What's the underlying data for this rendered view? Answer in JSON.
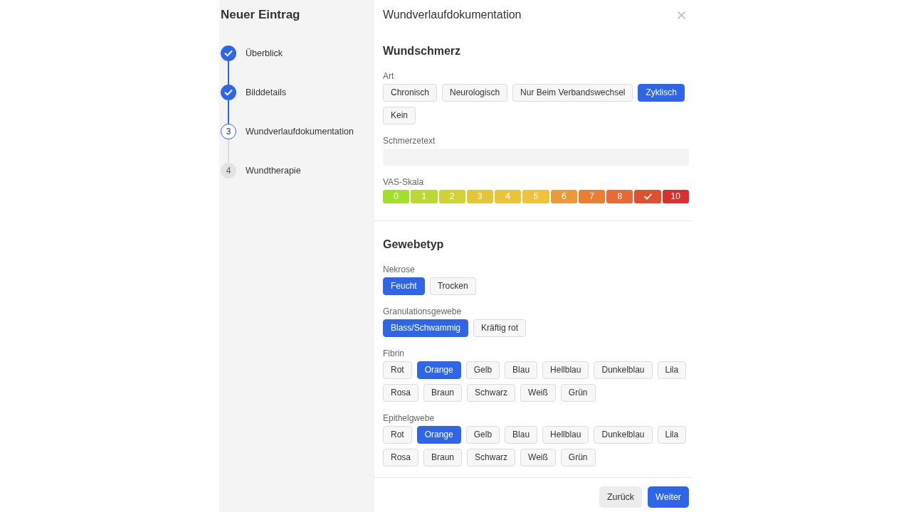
{
  "sidebar": {
    "title": "Neuer Eintrag",
    "steps": [
      {
        "label": "Überblick",
        "completed": true,
        "selected": false
      },
      {
        "label": "Bilddetails",
        "completed": true,
        "selected": false
      },
      {
        "label": "Wundverlaufdokumentation",
        "completed": false,
        "selected": true,
        "number": "3"
      },
      {
        "label": "Wundtherapie",
        "completed": false,
        "selected": false,
        "number": "4"
      }
    ]
  },
  "dialog": {
    "title": "Wundverlaufdokumentation"
  },
  "sections": [
    {
      "title": "Wundschmerz",
      "fields": [
        {
          "kind": "chips",
          "label": "Art",
          "options": [
            {
              "label": "Chronisch",
              "selected": false
            },
            {
              "label": "Neurologisch",
              "selected": false
            },
            {
              "label": "Nur Beim Verbandswechsel",
              "selected": false
            },
            {
              "label": "Zyklisch",
              "selected": true
            },
            {
              "label": "Kein",
              "selected": false
            }
          ]
        },
        {
          "kind": "text",
          "label": "Schmerzetext"
        },
        {
          "kind": "scale",
          "label": "VAS-Skala",
          "segments": [
            {
              "label": "0",
              "color": "#a3e02b",
              "selected": false
            },
            {
              "label": "1",
              "color": "#bcd835",
              "selected": false
            },
            {
              "label": "2",
              "color": "#d1d236",
              "selected": false
            },
            {
              "label": "3",
              "color": "#e3c63a",
              "selected": false
            },
            {
              "label": "4",
              "color": "#eac53b",
              "selected": false
            },
            {
              "label": "5",
              "color": "#ecc33b",
              "selected": false
            },
            {
              "label": "6",
              "color": "#ec9a39",
              "selected": false
            },
            {
              "label": "7",
              "color": "#e97f35",
              "selected": false
            },
            {
              "label": "8",
              "color": "#e56a33",
              "selected": false
            },
            {
              "color": "#df502d",
              "selected": true
            },
            {
              "label": "10",
              "color": "#d8302e",
              "selected": false
            }
          ]
        }
      ]
    },
    {
      "title": "Gewebetyp",
      "fields": [
        {
          "kind": "chips",
          "label": "Nekrose",
          "options": [
            {
              "label": "Feucht",
              "selected": true
            },
            {
              "label": "Trocken",
              "selected": false
            }
          ]
        },
        {
          "kind": "chips",
          "label": "Granulationsgewebe",
          "options": [
            {
              "label": "Blass/Schwammig",
              "selected": true
            },
            {
              "label": "Kräftig rot",
              "selected": false
            }
          ]
        },
        {
          "kind": "chips",
          "label": "Fibrin",
          "options": [
            {
              "label": "Rot",
              "selected": false
            },
            {
              "label": "Orange",
              "selected": true
            },
            {
              "label": "Gelb",
              "selected": false
            },
            {
              "label": "Blau",
              "selected": false
            },
            {
              "label": "Hellblau",
              "selected": false
            },
            {
              "label": "Dunkelblau",
              "selected": false
            },
            {
              "label": "Lila",
              "selected": false
            },
            {
              "label": "Rosa",
              "selected": false
            },
            {
              "label": "Braun",
              "selected": false
            },
            {
              "label": "Schwarz",
              "selected": false
            },
            {
              "label": "Weiß",
              "selected": false
            },
            {
              "label": "Grün",
              "selected": false
            }
          ]
        },
        {
          "kind": "chips",
          "label": "Epithelgwebe",
          "options": [
            {
              "label": "Rot",
              "selected": false
            },
            {
              "label": "Orange",
              "selected": true
            },
            {
              "label": "Gelb",
              "selected": false
            },
            {
              "label": "Blau",
              "selected": false
            },
            {
              "label": "Hellblau",
              "selected": false
            },
            {
              "label": "Dunkelblau",
              "selected": false
            },
            {
              "label": "Lila",
              "selected": false
            },
            {
              "label": "Rosa",
              "selected": false
            },
            {
              "label": "Braun",
              "selected": false
            },
            {
              "label": "Schwarz",
              "selected": false
            },
            {
              "label": "Weiß",
              "selected": false
            },
            {
              "label": "Grün",
              "selected": false
            }
          ]
        }
      ]
    }
  ],
  "footer": {
    "buttons": [
      {
        "label": "Zurück",
        "kind": "secondary"
      },
      {
        "label": "Weiter",
        "kind": "primary"
      }
    ]
  }
}
